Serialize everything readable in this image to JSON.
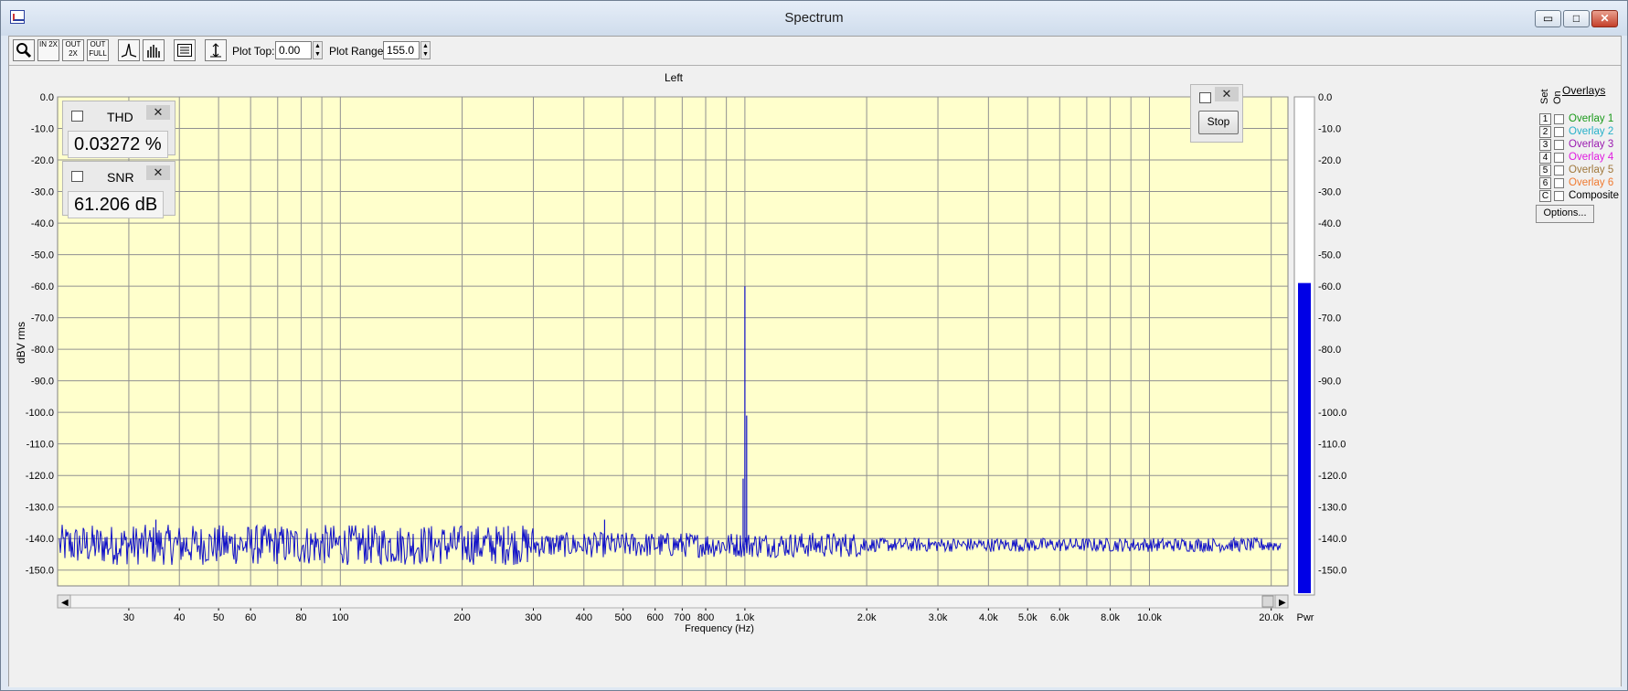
{
  "window": {
    "title": "Spectrum",
    "minimize_glyph": "▭",
    "maximize_glyph": "□",
    "close_glyph": "✕"
  },
  "toolbar": {
    "buttons": [
      {
        "name": "zoom-icon",
        "label": ""
      },
      {
        "name": "zoom-in-2x-icon",
        "label": "IN 2X"
      },
      {
        "name": "zoom-out-2x-icon",
        "label": "OUT 2X"
      },
      {
        "name": "zoom-out-full-icon",
        "label": "OUT FULL"
      },
      {
        "name": "peak-icon",
        "label": ""
      },
      {
        "name": "bars-icon",
        "label": ""
      },
      {
        "name": "settings-panel-icon",
        "label": ""
      },
      {
        "name": "cursor-marker-icon",
        "label": ""
      }
    ],
    "plot_top_label": "Plot Top:",
    "plot_top_value": "0.00",
    "plot_range_label": "Plot Range:",
    "plot_range_value": "155.0"
  },
  "thd": {
    "name": "THD",
    "value": "0.03272 %",
    "close": "✕"
  },
  "snr": {
    "name": "SNR",
    "value": "61.206 dB",
    "close": "✕"
  },
  "stop_widget": {
    "button_label": "Stop",
    "close": "✕"
  },
  "overlays": {
    "title": "Overlays",
    "set_label": "Set",
    "on_label": "On",
    "items": [
      {
        "num": "1",
        "label": "Overlay 1",
        "color": "#1a9a1a"
      },
      {
        "num": "2",
        "label": "Overlay 2",
        "color": "#26b0c9"
      },
      {
        "num": "3",
        "label": "Overlay 3",
        "color": "#9a1ab0"
      },
      {
        "num": "4",
        "label": "Overlay 4",
        "color": "#e01ae0"
      },
      {
        "num": "5",
        "label": "Overlay 5",
        "color": "#a0783c"
      },
      {
        "num": "6",
        "label": "Overlay 6",
        "color": "#f07a30"
      },
      {
        "num": "C",
        "label": "Composite",
        "color": "#000000"
      }
    ],
    "options_label": "Options..."
  },
  "chart_data": {
    "type": "line",
    "title": "Left",
    "xlabel": "Frequency (Hz)",
    "ylabel": "dBV rms",
    "x_scale": "log",
    "xlim": [
      20,
      22000
    ],
    "ylim": [
      -155,
      0
    ],
    "grid": true,
    "background": "#ffffcc",
    "line_color": "#1010c8",
    "x_ticks": [
      {
        "v": 30,
        "label": "30"
      },
      {
        "v": 40,
        "label": "40"
      },
      {
        "v": 50,
        "label": "50"
      },
      {
        "v": 60,
        "label": "60"
      },
      {
        "v": 80,
        "label": "80"
      },
      {
        "v": 100,
        "label": "100"
      },
      {
        "v": 200,
        "label": "200"
      },
      {
        "v": 300,
        "label": "300"
      },
      {
        "v": 400,
        "label": "400"
      },
      {
        "v": 500,
        "label": "500"
      },
      {
        "v": 600,
        "label": "600"
      },
      {
        "v": 700,
        "label": "700"
      },
      {
        "v": 800,
        "label": "800"
      },
      {
        "v": 1000,
        "label": "1.0k"
      },
      {
        "v": 2000,
        "label": "2.0k"
      },
      {
        "v": 3000,
        "label": "3.0k"
      },
      {
        "v": 4000,
        "label": "4.0k"
      },
      {
        "v": 5000,
        "label": "5.0k"
      },
      {
        "v": 6000,
        "label": "6.0k"
      },
      {
        "v": 8000,
        "label": "8.0k"
      },
      {
        "v": 10000,
        "label": "10.0k"
      },
      {
        "v": 20000,
        "label": "20.0k"
      }
    ],
    "x_grid_extra": [
      70,
      90,
      900,
      7000,
      9000
    ],
    "y_ticks": [
      0,
      -10,
      -20,
      -30,
      -40,
      -50,
      -60,
      -70,
      -80,
      -90,
      -100,
      -110,
      -120,
      -130,
      -140,
      -150
    ],
    "y_tick_labels": [
      "0.0",
      "-10.0",
      "-20.0",
      "-30.0",
      "-40.0",
      "-50.0",
      "-60.0",
      "-70.0",
      "-80.0",
      "-90.0",
      "-100.0",
      "-110.0",
      "-120.0",
      "-130.0",
      "-140.0",
      "-150.0"
    ],
    "series": [
      {
        "noise_floor_db": -142,
        "noise_spread_db": 4,
        "peaks": [
          {
            "x": 1000,
            "y": -60
          },
          {
            "x": 1010,
            "y": -101
          },
          {
            "x": 990,
            "y": -121
          },
          {
            "x": 35,
            "y": -134
          },
          {
            "x": 450,
            "y": -134
          },
          {
            "x": 260,
            "y": -136
          }
        ]
      }
    ],
    "power_meter": {
      "label": "Pwr",
      "level_db": -59,
      "color": "#0000e6"
    }
  }
}
